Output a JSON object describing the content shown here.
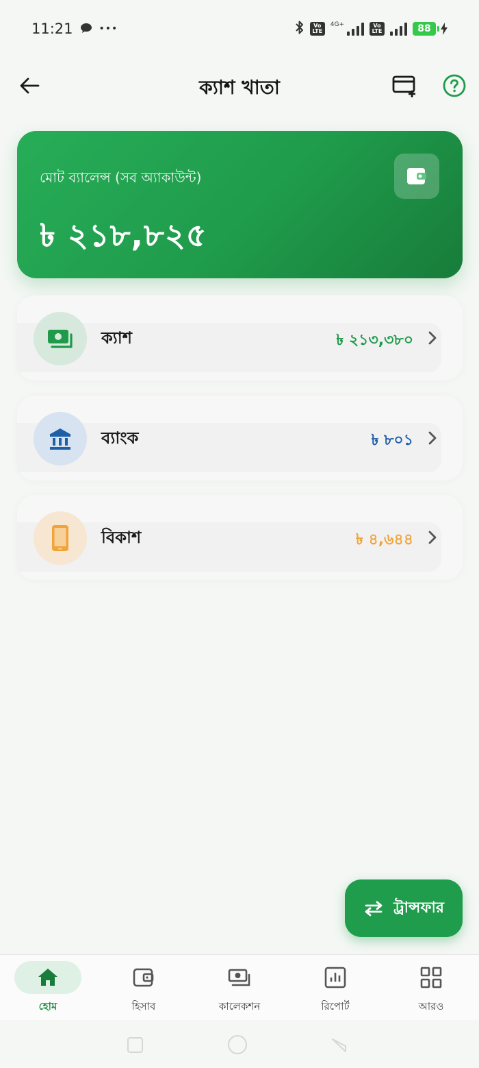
{
  "status_bar": {
    "time": "11:21",
    "more": "•••",
    "network_type": "4G+",
    "volte": "Vo LTE",
    "battery": "88",
    "icons": [
      "chat-bubble-icon",
      "bluetooth-icon",
      "signal-icon",
      "battery-charging-icon"
    ]
  },
  "header": {
    "title": "ক্যাশ খাতা",
    "icons": [
      "back-arrow-icon",
      "add-card-icon",
      "help-icon"
    ]
  },
  "balance": {
    "label": "মোট ব্যালেন্স (সব অ্যাকাউন্ট)",
    "amount": "৳ ২১৮,৮২৫",
    "icon": "wallet-icon"
  },
  "accounts": [
    {
      "name": "ক্যাশ",
      "amount": "৳ ২১৩,৩৮০",
      "icon": "cash-icon",
      "color": "#1f9a4b",
      "icon_bg": "#d6e9dc"
    },
    {
      "name": "ব্যাংক",
      "amount": "৳ ৮০১",
      "icon": "bank-icon",
      "color": "#1f5fa8",
      "icon_bg": "#d7e3f0"
    },
    {
      "name": "বিকাশ",
      "amount": "৳ ৪,৬৪৪",
      "icon": "mobile-phone-icon",
      "color": "#f0a43a",
      "icon_bg": "#f6e6d2"
    }
  ],
  "fab": {
    "label": "ট্রান্সফার",
    "icon": "transfer-arrows-icon"
  },
  "bottom_nav": {
    "items": [
      {
        "label": "হোম",
        "icon": "home-icon",
        "active": true
      },
      {
        "label": "হিসাব",
        "icon": "wallet-icon",
        "active": false
      },
      {
        "label": "কালেকশন",
        "icon": "cash-icon",
        "active": false
      },
      {
        "label": "রিপোর্ট",
        "icon": "report-chart-icon",
        "active": false
      },
      {
        "label": "আরও",
        "icon": "grid-icon",
        "active": false
      }
    ]
  },
  "colors": {
    "primary": "#1f9d4c",
    "background": "#f4f7f4",
    "cash": "#1f9a4b",
    "bank": "#1f5fa8",
    "bkash": "#f0a43a"
  }
}
